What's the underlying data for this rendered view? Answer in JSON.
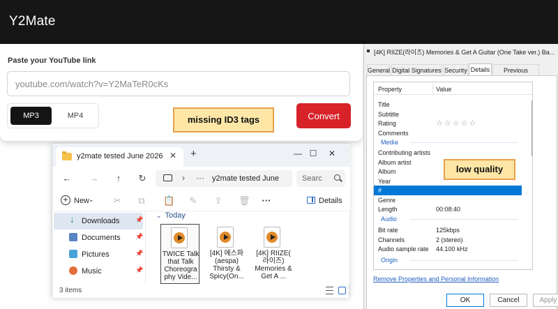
{
  "y2mate": {
    "brand": "Y2Mate",
    "paste_label": "Paste your YouTube link",
    "url_placeholder": "youtube.com/watch?v=Y2MaTeR0cKs",
    "format_mp3": "MP3",
    "format_mp4": "MP4",
    "selected_format": "MP3",
    "convert_label": "Convert",
    "accent_color": "#d7222a"
  },
  "annotations": {
    "id3": "missing ID3 tags",
    "quality": "low quality"
  },
  "explorer": {
    "tab_title": "y2mate tested June 2026",
    "tab_close": "✕",
    "tab_add": "+",
    "window_buttons": {
      "minimize": "—",
      "maximize": "☐",
      "close": "✕"
    },
    "nav_back": "←",
    "nav_forward": "→",
    "nav_up": "↑",
    "nav_refresh": "↻",
    "address_sep": "›",
    "address_dots": "···",
    "address_path": "y2mate tested June",
    "search_placeholder": "Searc",
    "toolbar": {
      "new_plus": "+",
      "new_label": "New",
      "new_chevron": "⌄",
      "cut": "✂",
      "copy": "⧉",
      "paste": "📋",
      "rename": "✎",
      "share": "⇪",
      "delete": "🗑",
      "more": "···",
      "details_label": "Details"
    },
    "nav_items": [
      {
        "label": "Downloads",
        "icon": "downloads-icon",
        "pinned": "📌"
      },
      {
        "label": "Documents",
        "icon": "documents-icon",
        "pinned": "📌"
      },
      {
        "label": "Pictures",
        "icon": "pictures-icon",
        "pinned": "📌"
      },
      {
        "label": "Music",
        "icon": "music-icon",
        "pinned": "📌"
      }
    ],
    "group_chevron": "⌄",
    "group_heading": "Today",
    "files": [
      {
        "name": "TWICE Talk that Talk Choreogra phy Vide..."
      },
      {
        "name": "[4K] 에스파 (aespa) Thirsty & Spicy(On..."
      },
      {
        "name": "[4K] RIIZE( 라이즈) Memories & Get A ..."
      }
    ],
    "item_count": "3 items"
  },
  "properties": {
    "title": "[4K] RIIZE(라이즈) Memories & Get A Guitar (One Take ver.) Ba...",
    "tabs": [
      "General",
      "Digital Signatures",
      "Security",
      "Details",
      "Previous Versions"
    ],
    "active_tab": "Details",
    "col_property": "Property",
    "col_value": "Value",
    "rows": [
      {
        "key": "Title",
        "value": ""
      },
      {
        "key": "Subtitle",
        "value": ""
      },
      {
        "key": "Rating",
        "value": "☆☆☆☆☆"
      },
      {
        "key": "Comments",
        "value": ""
      },
      {
        "key": "Media",
        "value": ""
      },
      {
        "key": "Contributing artists",
        "value": ""
      },
      {
        "key": "Album artist",
        "value": ""
      },
      {
        "key": "Album",
        "value": ""
      },
      {
        "key": "Year",
        "value": ""
      },
      {
        "key": "#",
        "value": ""
      },
      {
        "key": "Genre",
        "value": ""
      },
      {
        "key": "Length",
        "value": "00:08:40"
      },
      {
        "key": "Audio",
        "value": ""
      },
      {
        "key": "Bit rate",
        "value": "125kbps"
      },
      {
        "key": "Channels",
        "value": "2 (stereo)"
      },
      {
        "key": "Audio sample rate",
        "value": "44.100 kHz"
      },
      {
        "key": "Origin",
        "value": ""
      }
    ],
    "rating_stars": 0,
    "link": "Remove Properties and Personal Information",
    "ok": "OK",
    "cancel": "Cancel",
    "apply": "Apply",
    "selection_color": "#0078d7"
  }
}
